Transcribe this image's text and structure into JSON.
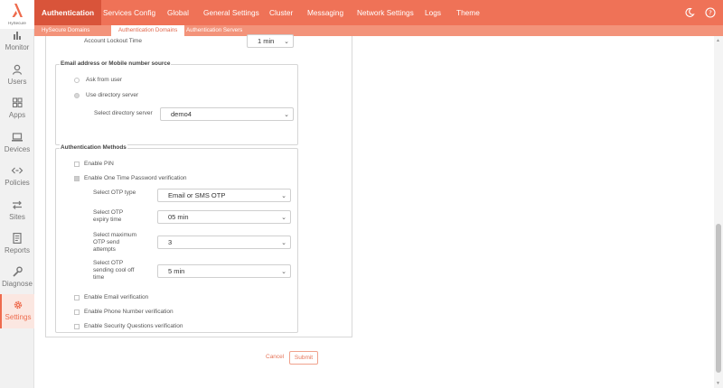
{
  "brand": {
    "name": "HySecure",
    "color": "#ee6b4d"
  },
  "sidebar": {
    "items": [
      {
        "label": "Monitor",
        "icon": "bar-chart-icon"
      },
      {
        "label": "Users",
        "icon": "user-icon"
      },
      {
        "label": "Apps",
        "icon": "apps-grid-icon"
      },
      {
        "label": "Devices",
        "icon": "laptop-icon"
      },
      {
        "label": "Policies",
        "icon": "code-arrows-icon"
      },
      {
        "label": "Sites",
        "icon": "swap-arrows-icon"
      },
      {
        "label": "Reports",
        "icon": "document-icon"
      },
      {
        "label": "Diagnose",
        "icon": "wrench-icon"
      },
      {
        "label": "Settings",
        "icon": "gear-icon",
        "active": true
      }
    ]
  },
  "topnav": {
    "tabs": [
      "Authentication",
      "Services Config",
      "Global",
      "General Settings",
      "Cluster",
      "Messaging",
      "Network Settings",
      "Logs",
      "Theme"
    ],
    "active": "Authentication"
  },
  "subnav": {
    "tabs": [
      "HySecure Domains",
      "Authentication Domains",
      "Authentication Servers"
    ],
    "active": "Authentication Domains"
  },
  "account_lockout": {
    "label": "Account Lockout Time",
    "value": "1 min"
  },
  "email_source": {
    "legend": "Email address or Mobile number source",
    "option_ask": "Ask from user",
    "option_directory": "Use directory server",
    "selected": "Use directory server",
    "directory_label": "Select directory server",
    "directory_value": "demo4"
  },
  "auth_methods": {
    "legend": "Authentication Methods",
    "enable_pin": {
      "label": "Enable PIN",
      "checked": false
    },
    "enable_otp": {
      "label": "Enable One Time Password verification",
      "checked": true
    },
    "otp_type": {
      "label": "Select OTP type",
      "value": "Email or SMS OTP"
    },
    "otp_expiry": {
      "label_line1": "Select OTP",
      "label_line2": "expiry time",
      "value": "05 min"
    },
    "otp_attempts": {
      "label_line1": "Select maximum",
      "label_line2": "OTP send",
      "label_line3": "attempts",
      "value": "3"
    },
    "otp_cooloff": {
      "label_line1": "Select OTP",
      "label_line2": "sending cool off",
      "label_line3": "time",
      "value": "5 min"
    },
    "enable_email": {
      "label": "Enable Email verification",
      "checked": false
    },
    "enable_phone": {
      "label": "Enable Phone Number verification",
      "checked": false
    },
    "enable_security_q": {
      "label": "Enable Security Questions verification",
      "checked": false
    }
  },
  "actions": {
    "cancel": "Cancel",
    "submit": "Submit"
  },
  "topbar_icons": [
    "moon-icon",
    "help-icon"
  ]
}
